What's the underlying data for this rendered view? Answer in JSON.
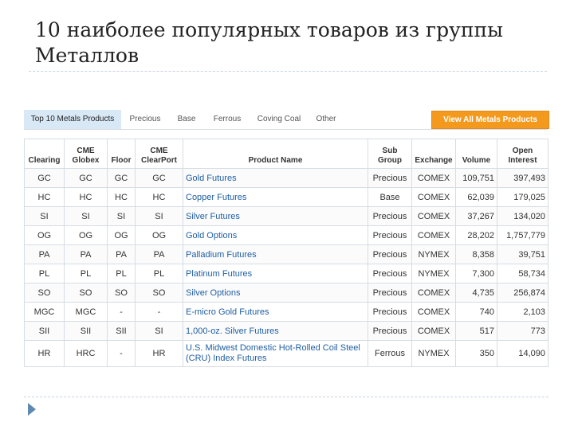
{
  "slide": {
    "title": "10 наиболее популярных товаров из группы Металлов"
  },
  "tabs": [
    {
      "label": "Top 10 Metals Products",
      "active": true
    },
    {
      "label": "Precious",
      "active": false
    },
    {
      "label": "Base",
      "active": false
    },
    {
      "label": "Ferrous",
      "active": false
    },
    {
      "label": "Coving Coal",
      "active": false
    },
    {
      "label": "Other",
      "active": false
    }
  ],
  "view_all_label": "View All Metals Products",
  "colors": {
    "accent": "#f39a1e",
    "link": "#1f5fa3",
    "active_tab": "#d9e8f5"
  },
  "table": {
    "headers": [
      "Clearing",
      "CME Globex",
      "Floor",
      "CME ClearPort",
      "Product Name",
      "Sub Group",
      "Exchange",
      "Volume",
      "Open Interest"
    ],
    "rows": [
      [
        "GC",
        "GC",
        "GC",
        "GC",
        "Gold Futures",
        "Precious",
        "COMEX",
        "109,751",
        "397,493"
      ],
      [
        "HC",
        "HC",
        "HC",
        "HC",
        "Copper Futures",
        "Base",
        "COMEX",
        "62,039",
        "179,025"
      ],
      [
        "SI",
        "SI",
        "SI",
        "SI",
        "Silver Futures",
        "Precious",
        "COMEX",
        "37,267",
        "134,020"
      ],
      [
        "OG",
        "OG",
        "OG",
        "OG",
        "Gold Options",
        "Precious",
        "COMEX",
        "28,202",
        "1,757,779"
      ],
      [
        "PA",
        "PA",
        "PA",
        "PA",
        "Palladium Futures",
        "Precious",
        "NYMEX",
        "8,358",
        "39,751"
      ],
      [
        "PL",
        "PL",
        "PL",
        "PL",
        "Platinum Futures",
        "Precious",
        "NYMEX",
        "7,300",
        "58,734"
      ],
      [
        "SO",
        "SO",
        "SO",
        "SO",
        "Silver Options",
        "Precious",
        "COMEX",
        "4,735",
        "256,874"
      ],
      [
        "MGC",
        "MGC",
        "-",
        "-",
        "E-micro Gold Futures",
        "Precious",
        "COMEX",
        "740",
        "2,103"
      ],
      [
        "SII",
        "SII",
        "SII",
        "SI",
        "1,000-oz. Silver Futures",
        "Precious",
        "COMEX",
        "517",
        "773"
      ],
      [
        "HR",
        "HRC",
        "-",
        "HR",
        "U.S. Midwest Domestic Hot-Rolled Coil Steel (CRU) Index Futures",
        "Ferrous",
        "NYMEX",
        "350",
        "14,090"
      ]
    ]
  }
}
